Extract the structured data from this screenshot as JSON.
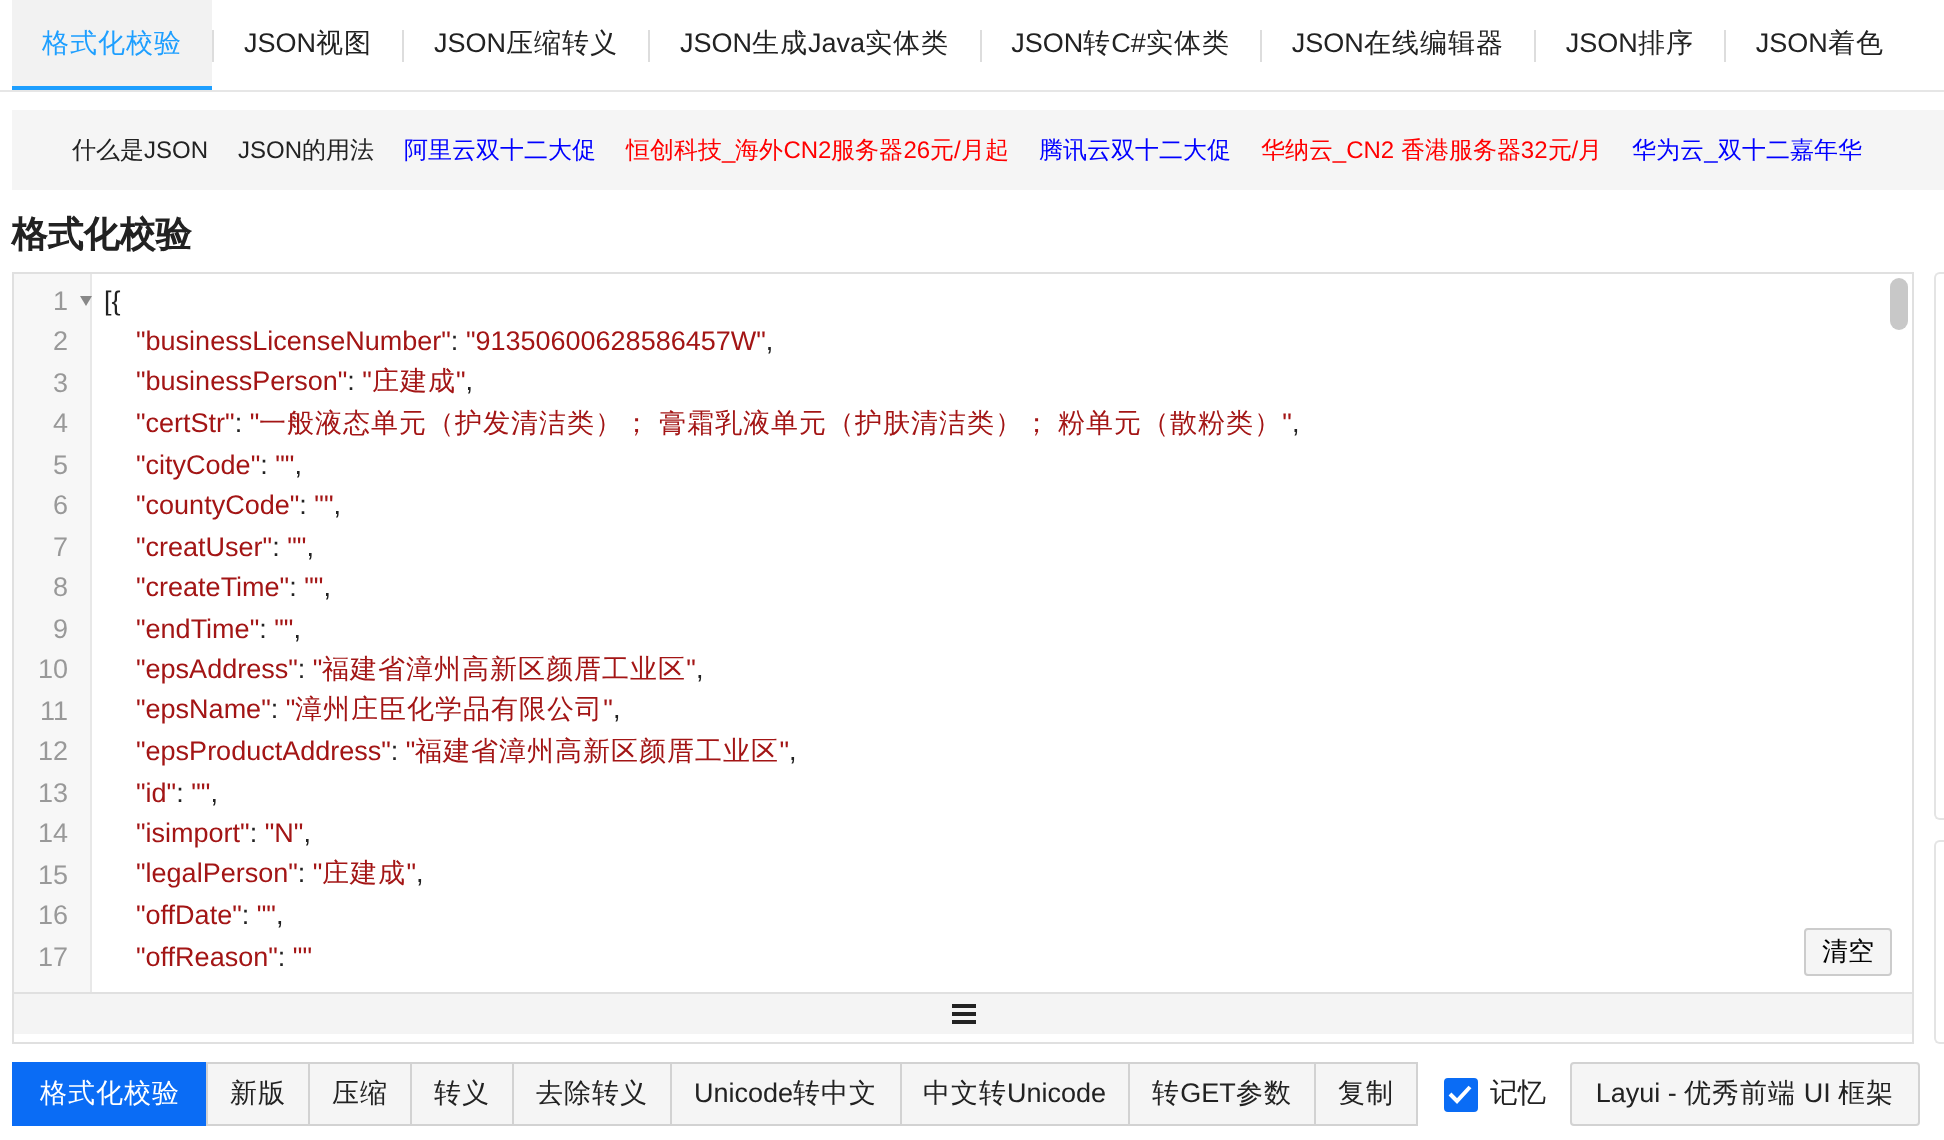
{
  "tabs": [
    {
      "label": "格式化校验",
      "selected": true
    },
    {
      "label": "JSON视图",
      "selected": false
    },
    {
      "label": "JSON压缩转义",
      "selected": false
    },
    {
      "label": "JSON生成Java实体类",
      "selected": false
    },
    {
      "label": "JSON转C#实体类",
      "selected": false
    },
    {
      "label": "JSON在线编辑器",
      "selected": false
    },
    {
      "label": "JSON排序",
      "selected": false
    },
    {
      "label": "JSON着色",
      "selected": false
    }
  ],
  "links": [
    {
      "label": "什么是JSON",
      "color": "#222222"
    },
    {
      "label": "JSON的用法",
      "color": "#222222"
    },
    {
      "label": "阿里云双十二大促",
      "color": "#0000ff"
    },
    {
      "label": "恒创科技_海外CN2服务器26元/月起",
      "color": "#ff0000"
    },
    {
      "label": "腾讯云双十二大促",
      "color": "#0000ff"
    },
    {
      "label": "华纳云_CN2 香港服务器32元/月",
      "color": "#ff0000"
    },
    {
      "label": "华为云_双十二嘉年华",
      "color": "#0000ff"
    }
  ],
  "heading": "格式化校验",
  "editor": {
    "lines": [
      {
        "number": "1",
        "foldable": true,
        "indent": false,
        "tokens": [
          {
            "text": "[{",
            "kind": "punct"
          }
        ]
      },
      {
        "number": "2",
        "foldable": false,
        "indent": true,
        "tokens": [
          {
            "text": "\"businessLicenseNumber\"",
            "kind": "string"
          },
          {
            "text": ": ",
            "kind": "punct"
          },
          {
            "text": "\"91350600628586457W\"",
            "kind": "string"
          },
          {
            "text": ",",
            "kind": "punct"
          }
        ]
      },
      {
        "number": "3",
        "foldable": false,
        "indent": true,
        "tokens": [
          {
            "text": "\"businessPerson\"",
            "kind": "string"
          },
          {
            "text": ": ",
            "kind": "punct"
          },
          {
            "text": "\"庄建成\"",
            "kind": "string"
          },
          {
            "text": ",",
            "kind": "punct"
          }
        ]
      },
      {
        "number": "4",
        "foldable": false,
        "indent": true,
        "tokens": [
          {
            "text": "\"certStr\"",
            "kind": "string"
          },
          {
            "text": ": ",
            "kind": "punct"
          },
          {
            "text": "\"一般液态单元（护发清洁类）； 膏霜乳液单元（护肤清洁类）； 粉单元（散粉类）\"",
            "kind": "string"
          },
          {
            "text": ",",
            "kind": "punct"
          }
        ]
      },
      {
        "number": "5",
        "foldable": false,
        "indent": true,
        "tokens": [
          {
            "text": "\"cityCode\"",
            "kind": "string"
          },
          {
            "text": ": ",
            "kind": "punct"
          },
          {
            "text": "\"\"",
            "kind": "string"
          },
          {
            "text": ",",
            "kind": "punct"
          }
        ]
      },
      {
        "number": "6",
        "foldable": false,
        "indent": true,
        "tokens": [
          {
            "text": "\"countyCode\"",
            "kind": "string"
          },
          {
            "text": ": ",
            "kind": "punct"
          },
          {
            "text": "\"\"",
            "kind": "string"
          },
          {
            "text": ",",
            "kind": "punct"
          }
        ]
      },
      {
        "number": "7",
        "foldable": false,
        "indent": true,
        "tokens": [
          {
            "text": "\"creatUser\"",
            "kind": "string"
          },
          {
            "text": ": ",
            "kind": "punct"
          },
          {
            "text": "\"\"",
            "kind": "string"
          },
          {
            "text": ",",
            "kind": "punct"
          }
        ]
      },
      {
        "number": "8",
        "foldable": false,
        "indent": true,
        "tokens": [
          {
            "text": "\"createTime\"",
            "kind": "string"
          },
          {
            "text": ": ",
            "kind": "punct"
          },
          {
            "text": "\"\"",
            "kind": "string"
          },
          {
            "text": ",",
            "kind": "punct"
          }
        ]
      },
      {
        "number": "9",
        "foldable": false,
        "indent": true,
        "tokens": [
          {
            "text": "\"endTime\"",
            "kind": "string"
          },
          {
            "text": ": ",
            "kind": "punct"
          },
          {
            "text": "\"\"",
            "kind": "string"
          },
          {
            "text": ",",
            "kind": "punct"
          }
        ]
      },
      {
        "number": "10",
        "foldable": false,
        "indent": true,
        "tokens": [
          {
            "text": "\"epsAddress\"",
            "kind": "string"
          },
          {
            "text": ": ",
            "kind": "punct"
          },
          {
            "text": "\"福建省漳州高新区颜厝工业区\"",
            "kind": "string"
          },
          {
            "text": ",",
            "kind": "punct"
          }
        ]
      },
      {
        "number": "11",
        "foldable": false,
        "indent": true,
        "tokens": [
          {
            "text": "\"epsName\"",
            "kind": "string"
          },
          {
            "text": ": ",
            "kind": "punct"
          },
          {
            "text": "\"漳州庄臣化学品有限公司\"",
            "kind": "string"
          },
          {
            "text": ",",
            "kind": "punct"
          }
        ]
      },
      {
        "number": "12",
        "foldable": false,
        "indent": true,
        "tokens": [
          {
            "text": "\"epsProductAddress\"",
            "kind": "string"
          },
          {
            "text": ": ",
            "kind": "punct"
          },
          {
            "text": "\"福建省漳州高新区颜厝工业区\"",
            "kind": "string"
          },
          {
            "text": ",",
            "kind": "punct"
          }
        ]
      },
      {
        "number": "13",
        "foldable": false,
        "indent": true,
        "tokens": [
          {
            "text": "\"id\"",
            "kind": "string"
          },
          {
            "text": ": ",
            "kind": "punct"
          },
          {
            "text": "\"\"",
            "kind": "string"
          },
          {
            "text": ",",
            "kind": "punct"
          }
        ]
      },
      {
        "number": "14",
        "foldable": false,
        "indent": true,
        "tokens": [
          {
            "text": "\"isimport\"",
            "kind": "string"
          },
          {
            "text": ": ",
            "kind": "punct"
          },
          {
            "text": "\"N\"",
            "kind": "string"
          },
          {
            "text": ",",
            "kind": "punct"
          }
        ]
      },
      {
        "number": "15",
        "foldable": false,
        "indent": true,
        "tokens": [
          {
            "text": "\"legalPerson\"",
            "kind": "string"
          },
          {
            "text": ": ",
            "kind": "punct"
          },
          {
            "text": "\"庄建成\"",
            "kind": "string"
          },
          {
            "text": ",",
            "kind": "punct"
          }
        ]
      },
      {
        "number": "16",
        "foldable": false,
        "indent": true,
        "tokens": [
          {
            "text": "\"offDate\"",
            "kind": "string"
          },
          {
            "text": ": ",
            "kind": "punct"
          },
          {
            "text": "\"\"",
            "kind": "string"
          },
          {
            "text": ",",
            "kind": "punct"
          }
        ]
      },
      {
        "number": "17",
        "foldable": false,
        "indent": true,
        "tokens": [
          {
            "text": "\"offReason\"",
            "kind": "string"
          },
          {
            "text": ": ",
            "kind": "punct"
          },
          {
            "text": "\"\"",
            "kind": "string"
          }
        ]
      }
    ],
    "clear_button": "清空"
  },
  "buttons": [
    {
      "label": "格式化校验",
      "kind": "primary"
    },
    {
      "label": "新版",
      "kind": "plain"
    },
    {
      "label": "压缩",
      "kind": "plain"
    },
    {
      "label": "转义",
      "kind": "plain"
    },
    {
      "label": "去除转义",
      "kind": "plain"
    },
    {
      "label": "Unicode转中文",
      "kind": "plain"
    },
    {
      "label": "中文转Unicode",
      "kind": "plain"
    },
    {
      "label": "转GET参数",
      "kind": "plain"
    },
    {
      "label": "复制",
      "kind": "plain"
    }
  ],
  "remember": {
    "label": "记忆",
    "checked": true
  },
  "framework_button": "Layui - 优秀前端 UI 框架"
}
